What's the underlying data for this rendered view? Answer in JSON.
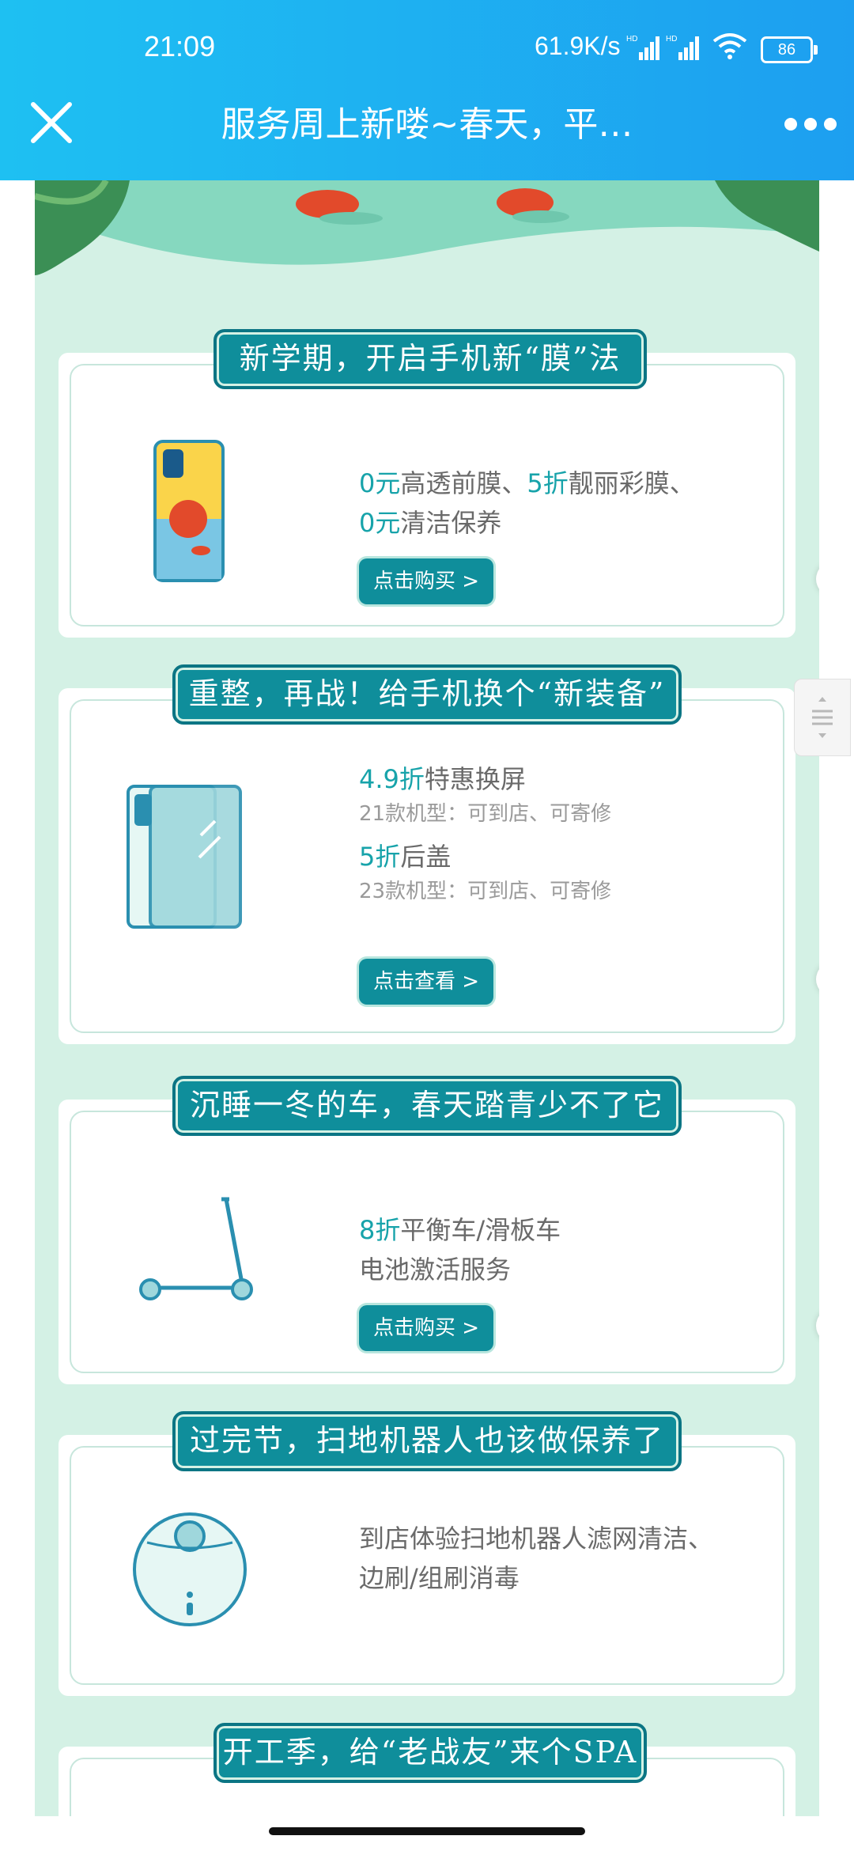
{
  "status_bar": {
    "time": "21:09",
    "network_speed": "61.9K/s",
    "battery": "86",
    "signal_label": "HD"
  },
  "app_bar": {
    "title": "服务周上新喽~春天，平…",
    "close_icon": "close-icon",
    "more_icon": "more-dots-icon"
  },
  "sections": [
    {
      "ribbon": "新学期，开启手机新“膜”法",
      "line1_hl1": "0元",
      "line1_t1": "高透前膜、",
      "line1_hl2": "5折",
      "line1_t2": "靓丽彩膜、",
      "line2_hl": "0元",
      "line2_t": "清洁保养",
      "button": "点击购买 >"
    },
    {
      "ribbon": "重整，再战！给手机换个“新装备”",
      "item1_hl": "4.9折",
      "item1_t": "特惠换屏",
      "item1_sub": "21款机型：可到店、可寄修",
      "item2_hl": "5折",
      "item2_t": "后盖",
      "item2_sub": "23款机型：可到店、可寄修",
      "button": "点击查看 >"
    },
    {
      "ribbon": "沉睡一冬的车，春天踏青少不了它",
      "line1_hl": "8折",
      "line1_t": "平衡车/滑板车",
      "line2": "电池激活服务",
      "button": "点击购买 >"
    },
    {
      "ribbon": "过完节，扫地机器人也该做保养了",
      "line1": "到店体验扫地机器人滤网清洁、",
      "line2": "边刷/组刷消毒"
    },
    {
      "ribbon": "开工季，给“老战友”来个SPA"
    }
  ],
  "colors": {
    "app_bar": "#1ec0f2",
    "accent": "#0f8e9b",
    "highlight": "#17a3aa",
    "page_bg": "#d4f1e5"
  }
}
